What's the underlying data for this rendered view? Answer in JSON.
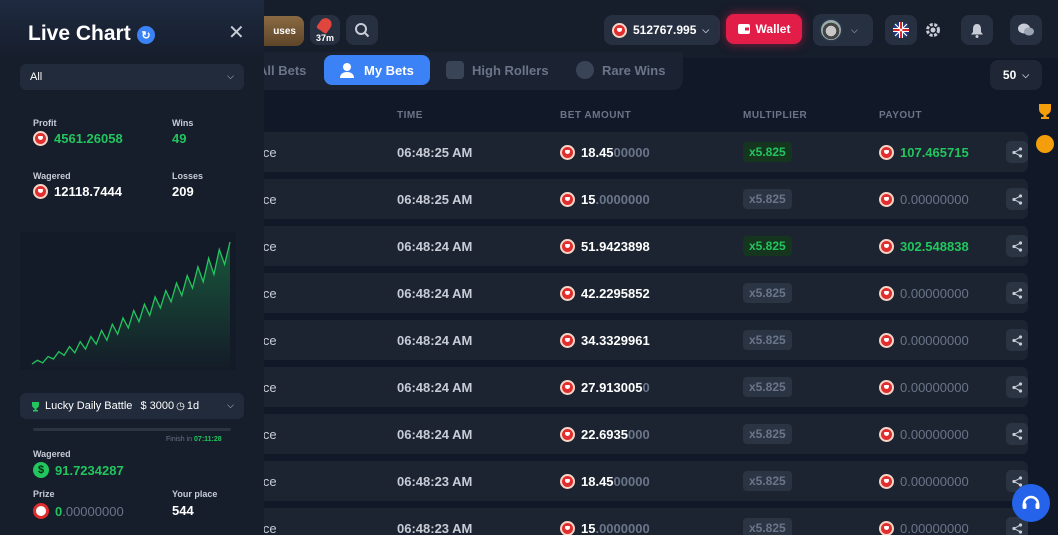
{
  "topbar": {
    "bonuses_label": "uses",
    "race_timer": "37m",
    "balance": "512767.995",
    "wallet_label": "Wallet"
  },
  "tabs": [
    {
      "label": "All Bets"
    },
    {
      "label": "My Bets"
    },
    {
      "label": "High Rollers"
    },
    {
      "label": "Rare Wins"
    }
  ],
  "per_page": "50",
  "table": {
    "headers": [
      "TIME",
      "BET AMOUNT",
      "MULTIPLIER",
      "PAYOUT"
    ],
    "rows": [
      {
        "game": "ice",
        "time": "06:48:25 AM",
        "bet_main": "18.45",
        "bet_dim": "00000",
        "multiplier": "x5.825",
        "win": true,
        "payout": "107.465715"
      },
      {
        "game": "ice",
        "time": "06:48:25 AM",
        "bet_main": "15",
        "bet_dim": ".0000000",
        "multiplier": "x5.825",
        "win": false,
        "payout": "0.00000000"
      },
      {
        "game": "ice",
        "time": "06:48:24 AM",
        "bet_main": "51.9423898",
        "bet_dim": "",
        "multiplier": "x5.825",
        "win": true,
        "payout": "302.548838"
      },
      {
        "game": "ice",
        "time": "06:48:24 AM",
        "bet_main": "42.2295852",
        "bet_dim": "",
        "multiplier": "x5.825",
        "win": false,
        "payout": "0.00000000"
      },
      {
        "game": "ice",
        "time": "06:48:24 AM",
        "bet_main": "34.3329961",
        "bet_dim": "",
        "multiplier": "x5.825",
        "win": false,
        "payout": "0.00000000"
      },
      {
        "game": "ice",
        "time": "06:48:24 AM",
        "bet_main": "27.913005",
        "bet_dim": "0",
        "multiplier": "x5.825",
        "win": false,
        "payout": "0.00000000"
      },
      {
        "game": "ice",
        "time": "06:48:24 AM",
        "bet_main": "22.6935",
        "bet_dim": "000",
        "multiplier": "x5.825",
        "win": false,
        "payout": "0.00000000"
      },
      {
        "game": "ice",
        "time": "06:48:23 AM",
        "bet_main": "18.45",
        "bet_dim": "00000",
        "multiplier": "x5.825",
        "win": false,
        "payout": "0.00000000"
      },
      {
        "game": "ice",
        "time": "06:48:23 AM",
        "bet_main": "15",
        "bet_dim": ".0000000",
        "multiplier": "x5.825",
        "win": false,
        "payout": "0.00000000"
      }
    ]
  },
  "panel": {
    "title": "Live Chart",
    "filter": "All",
    "profit_label": "Profit",
    "profit": "4561.26058",
    "wins_label": "Wins",
    "wins": "49",
    "wagered_label": "Wagered",
    "wagered": "12118.7444",
    "losses_label": "Losses",
    "losses": "209",
    "battle": {
      "name": "Lucky Daily Battle",
      "prize_pool": "$ 3000",
      "duration": "1d",
      "finish_label": "Finish in",
      "finish_time": "07:11:28",
      "wagered_label": "Wagered",
      "wagered": "91.7234287",
      "prize_label": "Prize",
      "prize_main": "0",
      "prize_dim": ".00000000",
      "place_label": "Your place",
      "place": "544"
    },
    "profit_curve": [
      2,
      5,
      3,
      8,
      6,
      12,
      9,
      16,
      11,
      20,
      14,
      24,
      18,
      29,
      21,
      34,
      26,
      39,
      31,
      45,
      36,
      50,
      41,
      56,
      47,
      61,
      52,
      67,
      57,
      73,
      63,
      80,
      68,
      87,
      74,
      94,
      82,
      100
    ]
  },
  "colors": {
    "accent": "#3b82f6",
    "wallet": "#e11d48",
    "win": "#22c55e",
    "muted": "#6b7589"
  }
}
